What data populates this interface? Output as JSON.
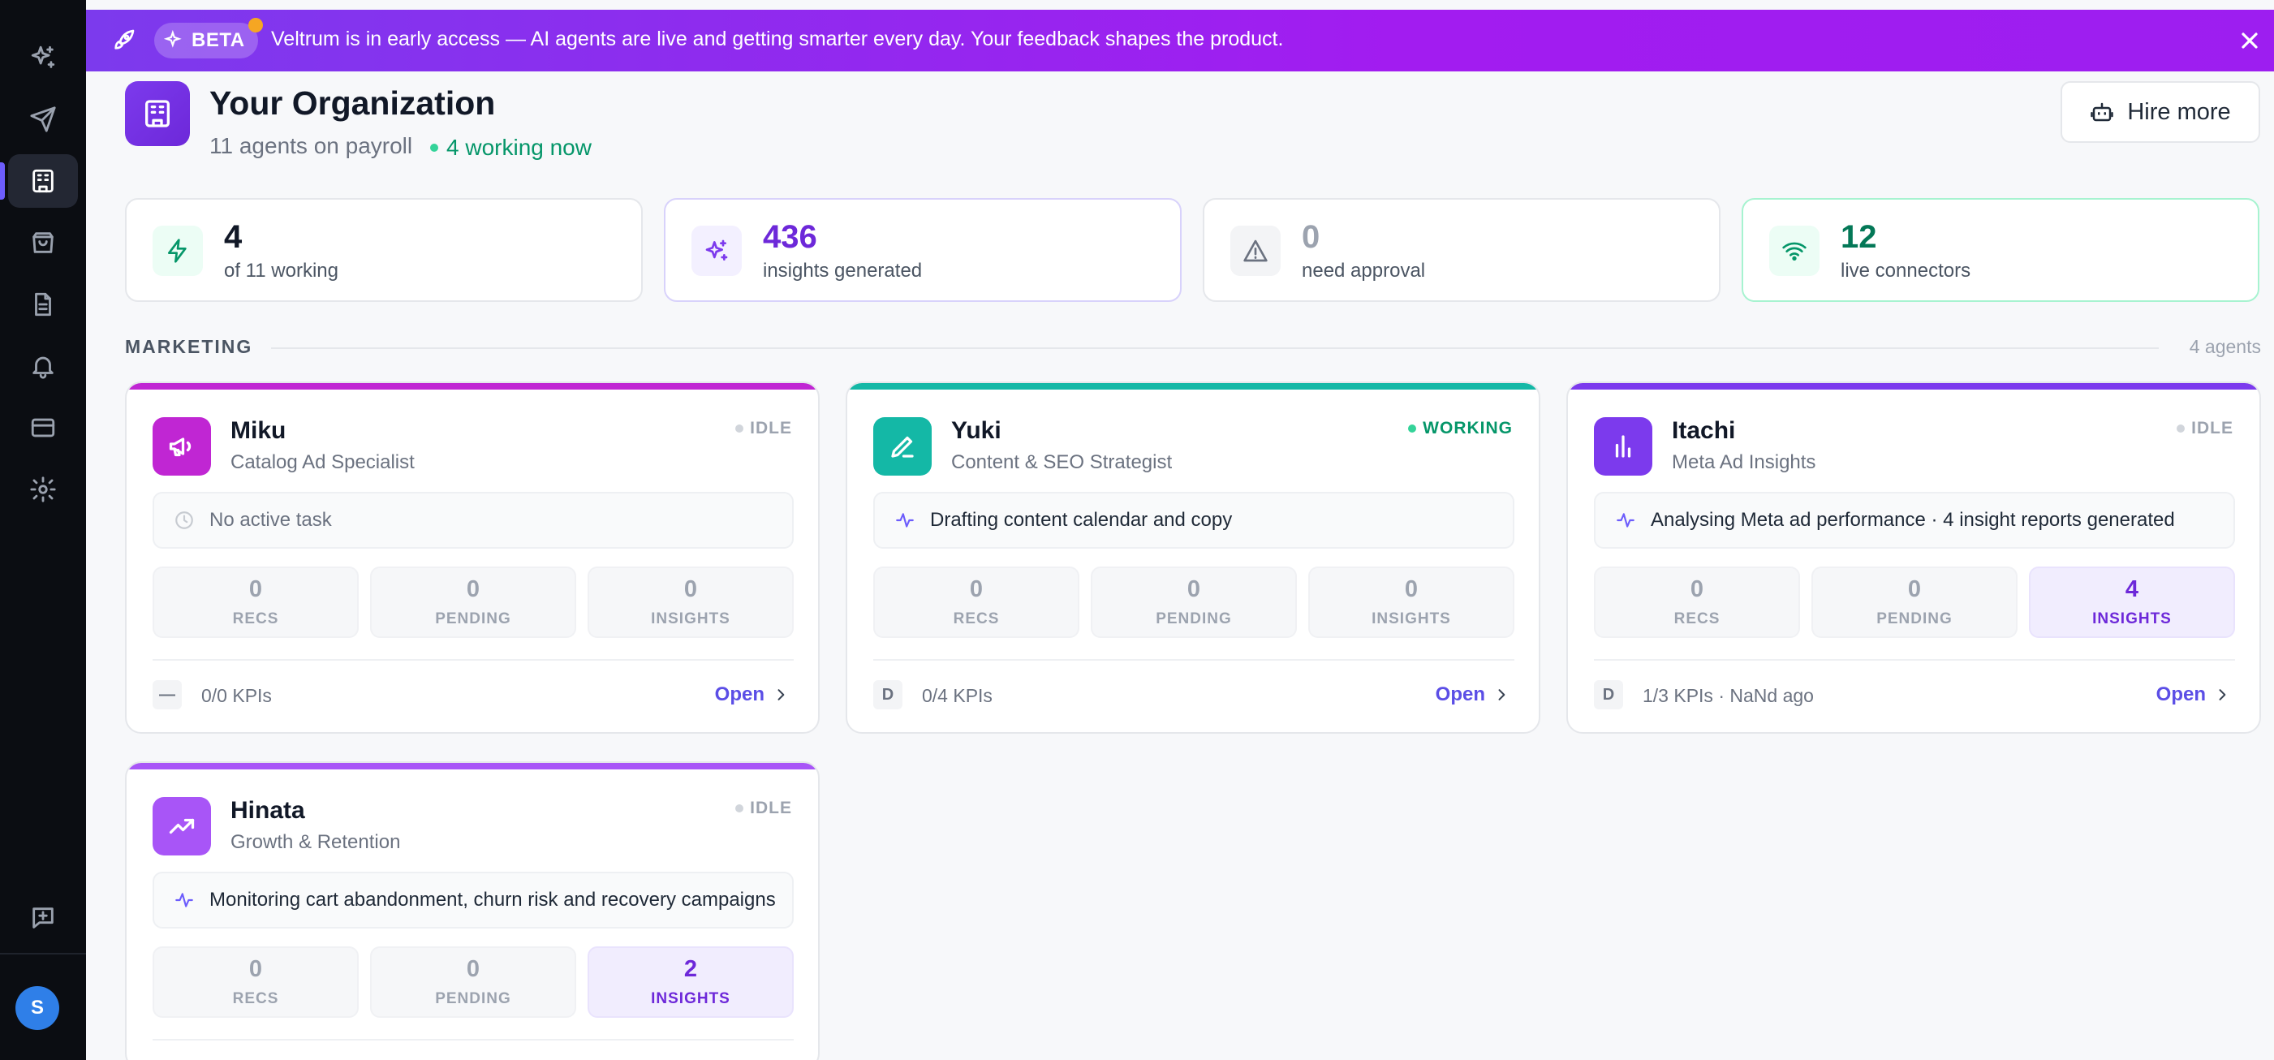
{
  "sidebar": {
    "items": [
      {
        "name": "sparkles-icon",
        "active": false
      },
      {
        "name": "send-icon",
        "active": false
      },
      {
        "name": "building-icon",
        "active": true
      },
      {
        "name": "shopping-bag-icon",
        "active": false
      },
      {
        "name": "document-icon",
        "active": false
      },
      {
        "name": "bell-icon",
        "active": false
      },
      {
        "name": "credit-card-icon",
        "active": false
      },
      {
        "name": "gear-icon",
        "active": false
      },
      {
        "name": "message-plus-icon",
        "active": false
      }
    ],
    "avatar_initial": "S"
  },
  "banner": {
    "badge": "BETA",
    "text": "Veltrum is in early access — AI agents are live and getting smarter every day. Your feedback shapes the product."
  },
  "header": {
    "title": "Your Organization",
    "subtitle": "11 agents on payroll",
    "working_now": "4 working now",
    "hire_button": "Hire more"
  },
  "stats": [
    {
      "value": "4",
      "label": "of 11 working",
      "color": "#111827",
      "icon": "lightning-icon"
    },
    {
      "value": "436",
      "label": "insights generated",
      "color": "#6d28d9",
      "icon": "sparkles-icon"
    },
    {
      "value": "0",
      "label": "need approval",
      "color": "#9ca3af",
      "icon": "warning-icon"
    },
    {
      "value": "12",
      "label": "live connectors",
      "color": "#047857",
      "icon": "wifi-icon"
    }
  ],
  "section": {
    "title": "MARKETING",
    "count": "4 agents"
  },
  "agents": [
    {
      "name": "Miku",
      "role": "Catalog Ad Specialist",
      "status": "IDLE",
      "task": "No active task",
      "metrics": [
        {
          "value": "0",
          "label": "RECS"
        },
        {
          "value": "0",
          "label": "PENDING"
        },
        {
          "value": "0",
          "label": "INSIGHTS"
        }
      ],
      "kpi_badge": "—",
      "kpi_text": "0/0 KPIs",
      "open": "Open",
      "accent": "#c026d3"
    },
    {
      "name": "Yuki",
      "role": "Content & SEO Strategist",
      "status": "WORKING",
      "task": "Drafting content calendar and copy",
      "metrics": [
        {
          "value": "0",
          "label": "RECS"
        },
        {
          "value": "0",
          "label": "PENDING"
        },
        {
          "value": "0",
          "label": "INSIGHTS"
        }
      ],
      "kpi_badge": "D",
      "kpi_text": "0/4 KPIs",
      "open": "Open",
      "accent": "#14b8a6"
    },
    {
      "name": "Itachi",
      "role": "Meta Ad Insights",
      "status": "IDLE",
      "task": "Analysing Meta ad performance · 4 insight reports generated",
      "metrics": [
        {
          "value": "0",
          "label": "RECS"
        },
        {
          "value": "0",
          "label": "PENDING"
        },
        {
          "value": "4",
          "label": "INSIGHTS"
        }
      ],
      "kpi_badge": "D",
      "kpi_text": "1/3 KPIs  · NaNd ago",
      "open": "Open",
      "accent": "#7c3aed"
    },
    {
      "name": "Hinata",
      "role": "Growth & Retention",
      "status": "IDLE",
      "task": "Monitoring cart abandonment, churn risk and recovery campaigns",
      "metrics": [
        {
          "value": "0",
          "label": "RECS"
        },
        {
          "value": "0",
          "label": "PENDING"
        },
        {
          "value": "2",
          "label": "INSIGHTS"
        }
      ],
      "accent": "#a855f7"
    }
  ]
}
